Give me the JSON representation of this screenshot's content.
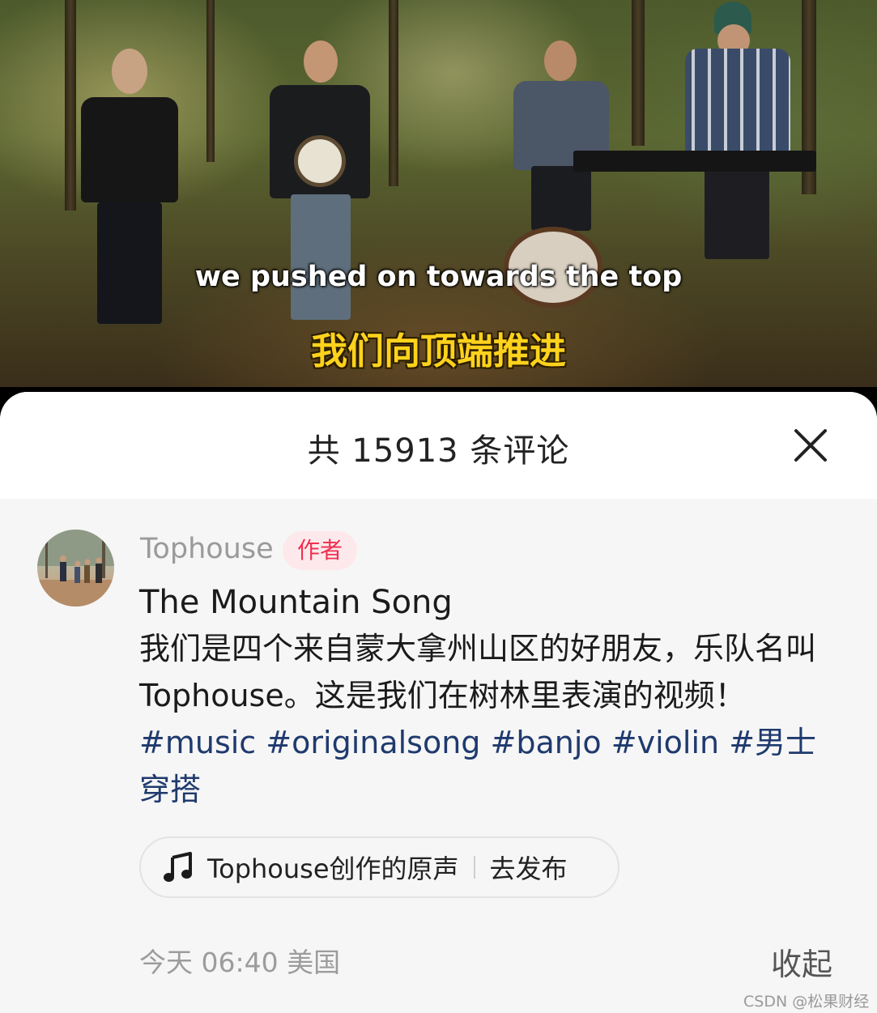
{
  "video": {
    "subtitle_en": "we pushed on towards the top",
    "subtitle_cn": "我们向顶端推进"
  },
  "comments_panel": {
    "title": "共 15913 条评论",
    "close_icon": "close-icon"
  },
  "comment": {
    "author": "Tophouse",
    "author_tag": "作者",
    "title_line": "The Mountain Song",
    "text": "我们是四个来自蒙大拿州山区的好朋友，乐队名叫 Tophouse。这是我们在树林里表演的视频！",
    "hashtags": [
      "#music",
      "#originalsong",
      "#banjo",
      "#violin",
      "#男士穿搭"
    ],
    "sound": {
      "icon": "music-note-icon",
      "label": "Tophouse创作的原声",
      "action": "去发布"
    },
    "time": "今天 06:40",
    "location": "美国",
    "collapse_label": "收起"
  },
  "watermark": "CSDN @松果财经",
  "colors": {
    "author_tag_text": "#f0304f",
    "author_tag_bg": "#fde9ec",
    "hashtag": "#1f3a6e",
    "subtitle_cn": "#ffd21c"
  }
}
